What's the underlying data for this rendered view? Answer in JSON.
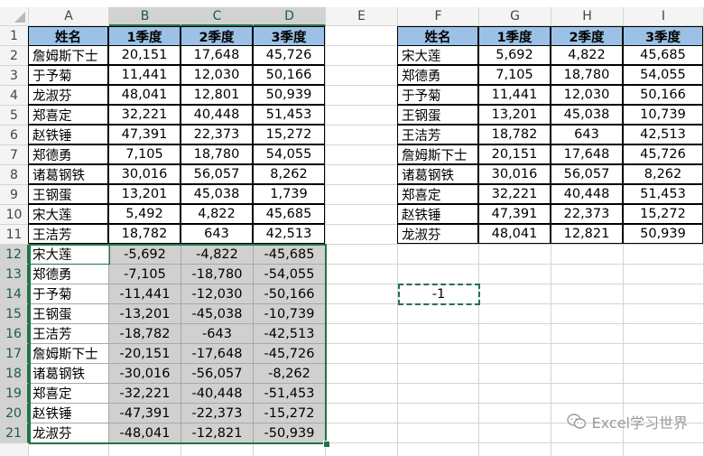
{
  "column_headers": [
    "A",
    "B",
    "C",
    "D",
    "E",
    "F",
    "G",
    "H",
    "I"
  ],
  "selected_columns": [
    "B",
    "C",
    "D"
  ],
  "row_headers": [
    "1",
    "2",
    "3",
    "4",
    "5",
    "6",
    "7",
    "8",
    "9",
    "10",
    "11",
    "12",
    "13",
    "14",
    "15",
    "16",
    "17",
    "18",
    "19",
    "20",
    "21"
  ],
  "selected_rows": [
    "12",
    "13",
    "14",
    "15",
    "16",
    "17",
    "18",
    "19",
    "20",
    "21"
  ],
  "left_table": {
    "header": [
      "姓名",
      "1季度",
      "2季度",
      "3季度"
    ],
    "rows": [
      [
        "詹姆斯下士",
        "20,151",
        "17,648",
        "45,726"
      ],
      [
        "于予菊",
        "11,441",
        "12,030",
        "50,166"
      ],
      [
        "龙淑芬",
        "48,041",
        "12,801",
        "50,939"
      ],
      [
        "郑喜定",
        "32,221",
        "40,448",
        "51,453"
      ],
      [
        "赵铁锤",
        "47,391",
        "22,373",
        "15,272"
      ],
      [
        "郑德勇",
        "7,105",
        "18,780",
        "54,055"
      ],
      [
        "诸葛钢铁",
        "30,016",
        "56,057",
        "8,262"
      ],
      [
        "王钢蛋",
        "13,201",
        "45,038",
        "1,739"
      ],
      [
        "宋大莲",
        "5,492",
        "4,822",
        "45,685"
      ],
      [
        "王洁芳",
        "18,782",
        "643",
        "42,513"
      ]
    ]
  },
  "result_rows": [
    [
      "宋大莲",
      "-5,692",
      "-4,822",
      "-45,685"
    ],
    [
      "郑德勇",
      "-7,105",
      "-18,780",
      "-54,055"
    ],
    [
      "于予菊",
      "-11,441",
      "-12,030",
      "-50,166"
    ],
    [
      "王钢蛋",
      "-13,201",
      "-45,038",
      "-10,739"
    ],
    [
      "王洁芳",
      "-18,782",
      "-643",
      "-42,513"
    ],
    [
      "詹姆斯下士",
      "-20,151",
      "-17,648",
      "-45,726"
    ],
    [
      "诸葛钢铁",
      "-30,016",
      "-56,057",
      "-8,262"
    ],
    [
      "郑喜定",
      "-32,221",
      "-40,448",
      "-51,453"
    ],
    [
      "赵铁锤",
      "-47,391",
      "-22,373",
      "-15,272"
    ],
    [
      "龙淑芬",
      "-48,041",
      "-12,821",
      "-50,939"
    ]
  ],
  "right_table": {
    "header": [
      "姓名",
      "1季度",
      "2季度",
      "3季度"
    ],
    "rows": [
      [
        "宋大莲",
        "5,692",
        "4,822",
        "45,685"
      ],
      [
        "郑德勇",
        "7,105",
        "18,780",
        "54,055"
      ],
      [
        "于予菊",
        "11,441",
        "12,030",
        "50,166"
      ],
      [
        "王钢蛋",
        "13,201",
        "45,038",
        "10,739"
      ],
      [
        "王洁芳",
        "18,782",
        "643",
        "42,513"
      ],
      [
        "詹姆斯下士",
        "20,151",
        "17,648",
        "45,726"
      ],
      [
        "诸葛钢铁",
        "30,016",
        "56,057",
        "8,262"
      ],
      [
        "郑喜定",
        "32,221",
        "40,448",
        "51,453"
      ],
      [
        "赵铁锤",
        "47,391",
        "22,373",
        "15,272"
      ],
      [
        "龙淑芬",
        "48,041",
        "12,821",
        "50,939"
      ]
    ]
  },
  "copied_cell": {
    "value": "-1"
  },
  "watermark": {
    "text": "Excel学习世界",
    "icon": "wechat-icon"
  },
  "colors": {
    "header_fill": "#9bc2e6",
    "selection_fill": "#d0d0d0",
    "selection_border": "#217346",
    "grid": "#d4d4d4",
    "table_border": "#000000"
  }
}
